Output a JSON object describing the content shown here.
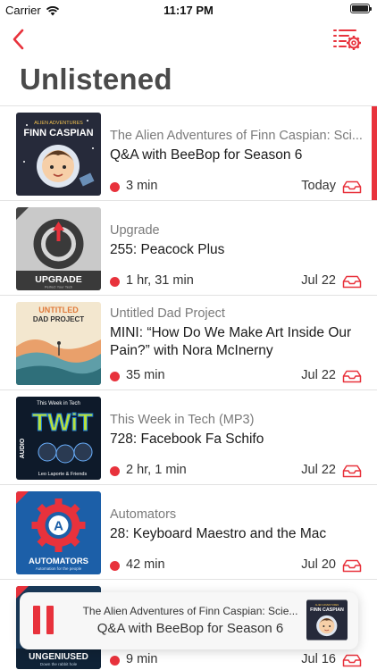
{
  "status_bar": {
    "carrier": "Carrier",
    "time": "11:17 PM",
    "battery_level": 1.0
  },
  "nav": {
    "back_icon": "chevron-left-icon",
    "settings_icon": "list-settings-icon",
    "accent": "#e8323c"
  },
  "page": {
    "title": "Unlistened"
  },
  "episodes": [
    {
      "podcast": "The Alien Adventures of Finn Caspian: Sci...",
      "title": "Q&A with BeeBop for Season 6",
      "duration": "3 min",
      "date": "Today",
      "art": {
        "top": "ALIEN ADVENTURES",
        "name": "FINN CASPIAN"
      }
    },
    {
      "podcast": "Upgrade",
      "title": "255: Peacock Plus",
      "duration": "1 hr, 31 min",
      "date": "Jul 22",
      "art": {
        "name": "UPGRADE",
        "sub": "Perfect Your Tech"
      }
    },
    {
      "podcast": "Untitled Dad Project",
      "title": "MINI: “How Do We Make Art Inside Our Pain?” with Nora McInerny",
      "duration": "35 min",
      "date": "Jul 22",
      "art": {
        "top": "UNTITLED",
        "name": "DAD PROJECT"
      }
    },
    {
      "podcast": "This Week in Tech (MP3)",
      "title": "728: Facebook Fa Schifo",
      "duration": "2 hr, 1 min",
      "date": "Jul 22",
      "art": {
        "top": "This Week in Tech",
        "name": "TWiT",
        "side": "AUDIO",
        "sub": "Leo Laporte & Friends"
      }
    },
    {
      "podcast": "Automators",
      "title": "28: Keyboard Maestro and the Mac",
      "duration": "42 min",
      "date": "Jul 20",
      "art": {
        "name": "AUTOMATORS",
        "sub": "Automation for the people",
        "letter": "A"
      }
    },
    {
      "podcast": "",
      "title": "",
      "duration": "9 min",
      "date": "Jul 16",
      "art": {
        "name": "UNGENIUSED",
        "sub": "Down the rabbit hole"
      }
    }
  ],
  "mini_player": {
    "podcast": "The Alien Adventures of Finn Caspian: Scie...",
    "title": "Q&A with BeeBop for Season 6",
    "state_icon": "pause-icon"
  }
}
